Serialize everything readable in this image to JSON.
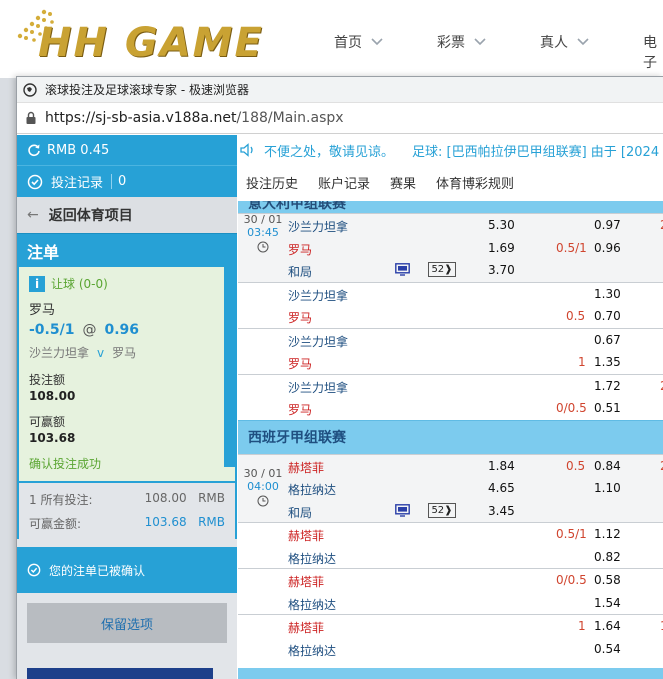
{
  "site": {
    "logo_text": "HH GAME",
    "nav": [
      "首页",
      "彩票",
      "真人",
      "电子"
    ]
  },
  "browser": {
    "title": "滚球投注及足球滚球专家 - 极速浏览器",
    "url_host": "https://sj-sb-asia.v188a.net",
    "url_path": "/188/Main.aspx"
  },
  "account": {
    "balance": "RMB 0.45",
    "bet_records_label": "投注记录",
    "bet_records_count": "0",
    "back_label": "返回体育项目"
  },
  "bet_slip": {
    "title": "注单",
    "market": "让球 (0-0)",
    "selection": "罗马",
    "handicap": "-0.5/1",
    "at": "@",
    "odds": "0.96",
    "home": "沙兰力坦拿",
    "vs": "v",
    "away": "罗马",
    "stake_label": "投注额",
    "stake_value": "108.00",
    "win_label": "可赢额",
    "win_value": "103.68",
    "success_msg": "确认投注成功",
    "all_bets_label": "1 所有投注:",
    "all_bets_value": "108.00",
    "all_bets_currency": "RMB",
    "win_total_label": "可赢金额:",
    "win_total_value": "103.68",
    "win_total_currency": "RMB",
    "confirmed_msg": "您的注单已被确认",
    "keep_selection": "保留选项"
  },
  "ticker": {
    "text1": "不便之处，敬请见谅。",
    "text2": "足球: [巴西帕拉伊巴甲组联赛] 由于 [2024"
  },
  "tabs": [
    "投注历史",
    "账户记录",
    "赛果",
    "体育博彩规则"
  ],
  "leagues": [
    {
      "name": "意大利甲组联赛",
      "kickoff_date": "30 / 01",
      "kickoff_time": "03:45",
      "tv_badge": "52",
      "main": {
        "home": "沙兰力坦拿",
        "away": "罗马",
        "draw": "和局",
        "home_1x2": "5.30",
        "away_1x2": "1.69",
        "draw_1x2": "3.70",
        "hcp_away": "0.5/1",
        "hcp_odds_home": "0.97",
        "hcp_odds_away": "0.96",
        "cut_home": "2"
      },
      "alt": [
        {
          "home": "沙兰力坦拿",
          "away": "罗马",
          "hcp": "",
          "hcp_side": "away",
          "hcp_away": "0.5",
          "odds_home": "1.30",
          "odds_away": "0.70",
          "cut": ""
        },
        {
          "home": "沙兰力坦拿",
          "away": "罗马",
          "hcp_away": "1",
          "odds_home": "0.67",
          "odds_away": "1.35",
          "cut": ""
        },
        {
          "home": "沙兰力坦拿",
          "away": "罗马",
          "hcp_away": "0/0.5",
          "odds_home": "1.72",
          "odds_away": "0.51",
          "cut": "2"
        }
      ]
    },
    {
      "name": "西班牙甲组联赛",
      "kickoff_date": "30 / 01",
      "kickoff_time": "04:00",
      "tv_badge": "52",
      "main": {
        "home": "赫塔菲",
        "away": "格拉纳达",
        "draw": "和局",
        "home_1x2": "1.84",
        "away_1x2": "4.65",
        "draw_1x2": "3.45",
        "hcp_home": "0.5",
        "hcp_odds_home": "0.84",
        "hcp_odds_away": "1.10",
        "cut_home": "2"
      },
      "alt": [
        {
          "home": "赫塔菲",
          "away": "格拉纳达",
          "hcp_home": "0.5/1",
          "odds_home": "1.12",
          "odds_away": "0.82"
        },
        {
          "home": "赫塔菲",
          "away": "格拉纳达",
          "hcp_home": "0/0.5",
          "odds_home": "0.58",
          "odds_away": "1.54"
        },
        {
          "home": "赫塔菲",
          "away": "格拉纳达",
          "hcp_home": "1",
          "odds_home": "1.64",
          "odds_away": "0.54",
          "cut": "1"
        }
      ]
    }
  ],
  "colors": {
    "accent": "#27a1d6",
    "league_band": "#7ccbee",
    "handicap_red": "#d0452f",
    "success_green": "#5aa532",
    "logo_gold": "#c9a233"
  }
}
